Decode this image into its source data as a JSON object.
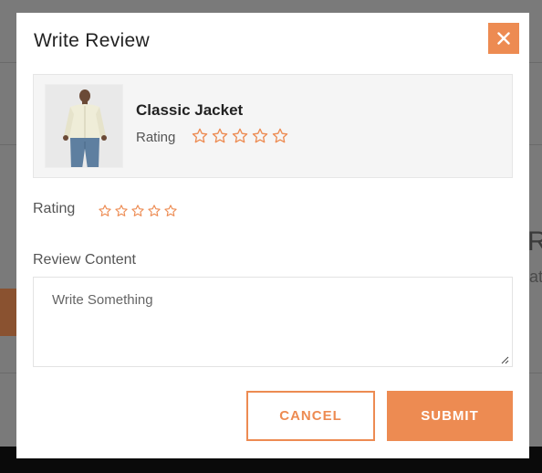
{
  "colors": {
    "accent": "#ed8b52",
    "star": "#ed8b52",
    "card_background": "#f5f5f5",
    "overlay": "#7a7a7a"
  },
  "modal": {
    "title": "Write Review",
    "close_icon": "close-icon"
  },
  "product": {
    "name": "Classic Jacket",
    "rating_label": "Rating",
    "rating_value": 0,
    "rating_max": 5,
    "image_icon": "product-photo"
  },
  "review": {
    "rating_label": "Rating",
    "rating_value": 0,
    "rating_max": 5,
    "content_label": "Review Content",
    "content_value": "",
    "content_placeholder": "Write Something"
  },
  "actions": {
    "cancel_label": "CANCEL",
    "submit_label": "SUBMIT"
  }
}
